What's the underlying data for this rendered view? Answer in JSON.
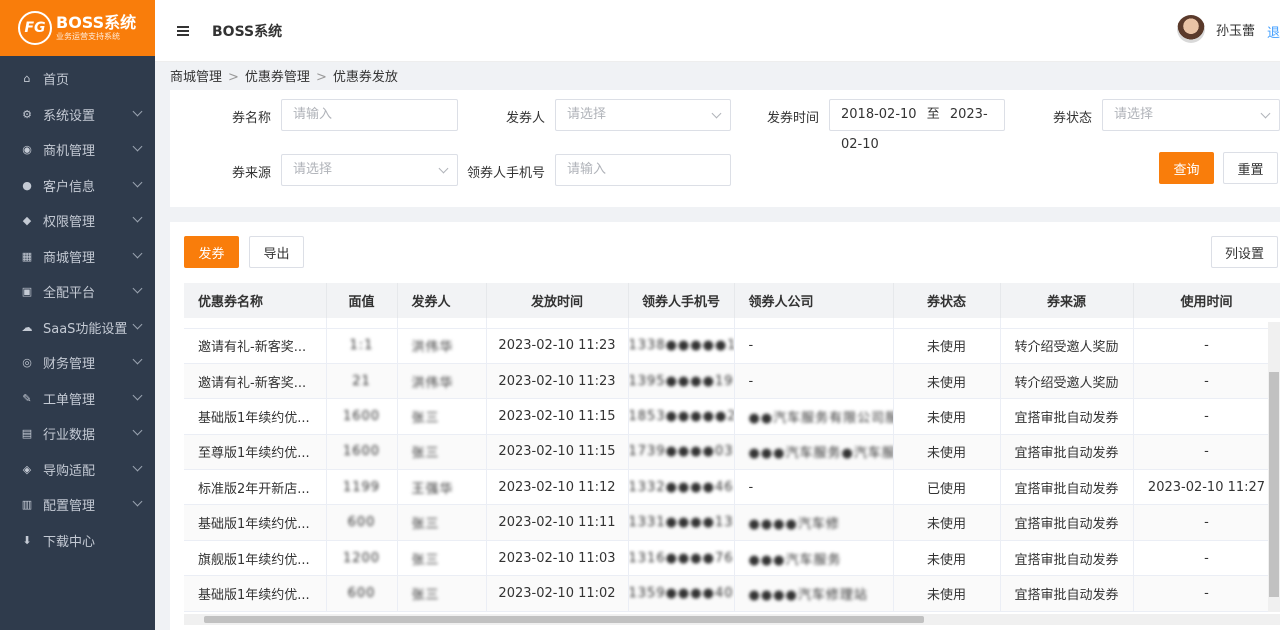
{
  "app": {
    "logo_title": "BOSS系统",
    "logo_sub": "业务运营支持系统",
    "header_title": "BOSS系统",
    "user_name": "孙玉蕾",
    "header_edge_text": "退"
  },
  "sidebar": {
    "items": [
      {
        "label": "首页",
        "icon": "home-icon",
        "glyph": "⌂",
        "arrow": false
      },
      {
        "label": "系统设置",
        "icon": "gear-icon",
        "glyph": "⚙",
        "arrow": true
      },
      {
        "label": "商机管理",
        "icon": "bag-icon",
        "glyph": "◉",
        "arrow": true
      },
      {
        "label": "客户信息",
        "icon": "user-icon",
        "glyph": "●",
        "arrow": true
      },
      {
        "label": "权限管理",
        "icon": "shield-icon",
        "glyph": "◆",
        "arrow": true
      },
      {
        "label": "商城管理",
        "icon": "store-icon",
        "glyph": "▦",
        "arrow": true
      },
      {
        "label": "全配平台",
        "icon": "platform-icon",
        "glyph": "▣",
        "arrow": true
      },
      {
        "label": "SaaS功能设置",
        "icon": "cloud-icon",
        "glyph": "☁",
        "arrow": true
      },
      {
        "label": "财务管理",
        "icon": "finance-icon",
        "glyph": "◎",
        "arrow": true
      },
      {
        "label": "工单管理",
        "icon": "wrench-icon",
        "glyph": "✎",
        "arrow": true
      },
      {
        "label": "行业数据",
        "icon": "data-icon",
        "glyph": "▤",
        "arrow": true
      },
      {
        "label": "导购适配",
        "icon": "layers-icon",
        "glyph": "◈",
        "arrow": true
      },
      {
        "label": "配置管理",
        "icon": "config-icon",
        "glyph": "▥",
        "arrow": true
      },
      {
        "label": "下载中心",
        "icon": "download-icon",
        "glyph": "⬇",
        "arrow": false
      }
    ]
  },
  "breadcrumb": [
    "商城管理",
    "优惠券管理",
    "优惠券发放"
  ],
  "filters": {
    "coupon_name_label": "券名称",
    "coupon_name_placeholder": "请输入",
    "issuer_label": "发券人",
    "issuer_placeholder": "请选择",
    "issue_time_label": "发券时间",
    "issue_time_start": "2018-02-10",
    "issue_time_sep": "至",
    "issue_time_end": "2023-02-10",
    "status_label": "券状态",
    "status_placeholder": "请选择",
    "source_label": "券来源",
    "source_placeholder": "请选择",
    "phone_label": "领券人手机号",
    "phone_placeholder": "请输入",
    "query_button": "查询",
    "reset_button": "重置"
  },
  "toolbar": {
    "issue_button": "发券",
    "export_button": "导出",
    "column_settings_button": "列设置"
  },
  "table": {
    "columns": [
      "优惠券名称",
      "面值",
      "发券人",
      "发放时间",
      "领券人手机号",
      "领券人公司",
      "券状态",
      "券来源",
      "使用时间"
    ],
    "rows": [
      {
        "name": "邀请有礼-新客奖...",
        "value": "1:1",
        "issuer": "洪伟华",
        "time": "2023-02-10 11:23",
        "phone": "1338●●●●●1",
        "company": "-",
        "status": "未使用",
        "source": "转介绍受邀人奖励",
        "used": "-"
      },
      {
        "name": "邀请有礼-新客奖...",
        "value": "21",
        "issuer": "洪伟华",
        "time": "2023-02-10 11:23",
        "phone": "1395●●●●19",
        "company": "-",
        "status": "未使用",
        "source": "转介绍受邀人奖励",
        "used": "-"
      },
      {
        "name": "基础版1年续约优...",
        "value": "1600",
        "issuer": "张三",
        "time": "2023-02-10 11:15",
        "phone": "1853●●●●●2",
        "company": "●●汽车服务有限公司服务...",
        "status": "未使用",
        "source": "宜搭审批自动发券",
        "used": "-"
      },
      {
        "name": "至尊版1年续约优...",
        "value": "1600",
        "issuer": "张三",
        "time": "2023-02-10 11:15",
        "phone": "1739●●●●03",
        "company": "●●●汽车服务●汽车服务...",
        "status": "未使用",
        "source": "宜搭审批自动发券",
        "used": "-"
      },
      {
        "name": "标准版2年开新店...",
        "value": "1199",
        "issuer": "王强华",
        "time": "2023-02-10 11:12",
        "phone": "1332●●●●46",
        "company": "-",
        "status": "已使用",
        "source": "宜搭审批自动发券",
        "used": "2023-02-10 11:27"
      },
      {
        "name": "基础版1年续约优...",
        "value": "600",
        "issuer": "张三",
        "time": "2023-02-10 11:11",
        "phone": "1331●●●●13",
        "company": "●●●●汽车修",
        "status": "未使用",
        "source": "宜搭审批自动发券",
        "used": "-"
      },
      {
        "name": "旗舰版1年续约优...",
        "value": "1200",
        "issuer": "张三",
        "time": "2023-02-10 11:03",
        "phone": "1316●●●●76",
        "company": "●●●汽车服务",
        "status": "未使用",
        "source": "宜搭审批自动发券",
        "used": "-"
      },
      {
        "name": "基础版1年续约优...",
        "value": "600",
        "issuer": "张三",
        "time": "2023-02-10 11:02",
        "phone": "1359●●●●40",
        "company": "●●●●汽车修理站",
        "status": "未使用",
        "source": "宜搭审批自动发券",
        "used": "-"
      }
    ]
  },
  "colors": {
    "accent": "#f97d0b",
    "sidebar_bg": "#2f3b4c"
  }
}
